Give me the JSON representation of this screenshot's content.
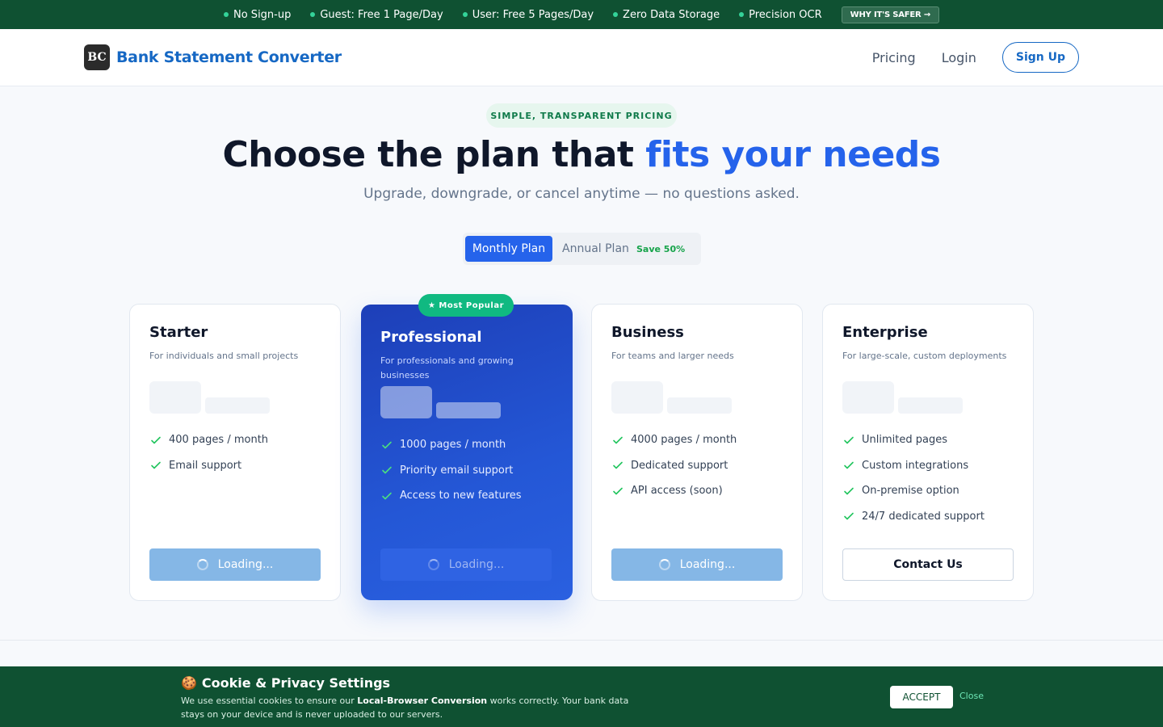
{
  "topbar": {
    "features": [
      "No Sign-up",
      "Guest: Free 1 Page/Day",
      "User: Free 5 Pages/Day",
      "Zero Data Storage",
      "Precision OCR"
    ],
    "why_button": "WHY IT'S SAFER →"
  },
  "header": {
    "logo_text": "BC",
    "brand": "Bank Statement Converter",
    "nav": {
      "pricing": "Pricing",
      "login": "Login",
      "signup": "Sign Up"
    }
  },
  "hero": {
    "pill": "SIMPLE, TRANSPARENT PRICING",
    "title_main": "Choose the plan that ",
    "title_accent": "fits your needs",
    "subtitle": "Upgrade, downgrade, or cancel anytime — no questions asked."
  },
  "billing": {
    "monthly": "Monthly Plan",
    "annual": "Annual Plan",
    "save": "Save 50%"
  },
  "plans": [
    {
      "name": "Starter",
      "desc": "For individuals and small projects",
      "features": [
        "400 pages / month",
        "Email support"
      ],
      "cta": "Loading..."
    },
    {
      "name": "Professional",
      "badge": "★ Most Popular",
      "desc": "For professionals and growing businesses",
      "features": [
        "1000 pages / month",
        "Priority email support",
        "Access to new features"
      ],
      "cta": "Loading..."
    },
    {
      "name": "Business",
      "desc": "For teams and larger needs",
      "features": [
        "4000 pages / month",
        "Dedicated support",
        "API access (soon)"
      ],
      "cta": "Loading..."
    },
    {
      "name": "Enterprise",
      "desc": "For large-scale, custom deployments",
      "features": [
        "Unlimited pages",
        "Custom integrations",
        "On-premise option",
        "24/7 dedicated support"
      ],
      "cta": "Contact Us"
    }
  ],
  "cookie": {
    "icon": "🍪",
    "title": "Cookie & Privacy Settings",
    "text_before": "We use essential cookies to ensure our ",
    "text_bold": "Local-Browser Conversion",
    "text_after": " works correctly. Your bank data stays on your device and is never uploaded to our servers.",
    "accept": "ACCEPT",
    "close": "Close"
  },
  "colors": {
    "brand_blue": "#1668c4",
    "accent_blue": "#2563eb",
    "green_bar": "#0f5132",
    "badge_green": "#10b981"
  }
}
